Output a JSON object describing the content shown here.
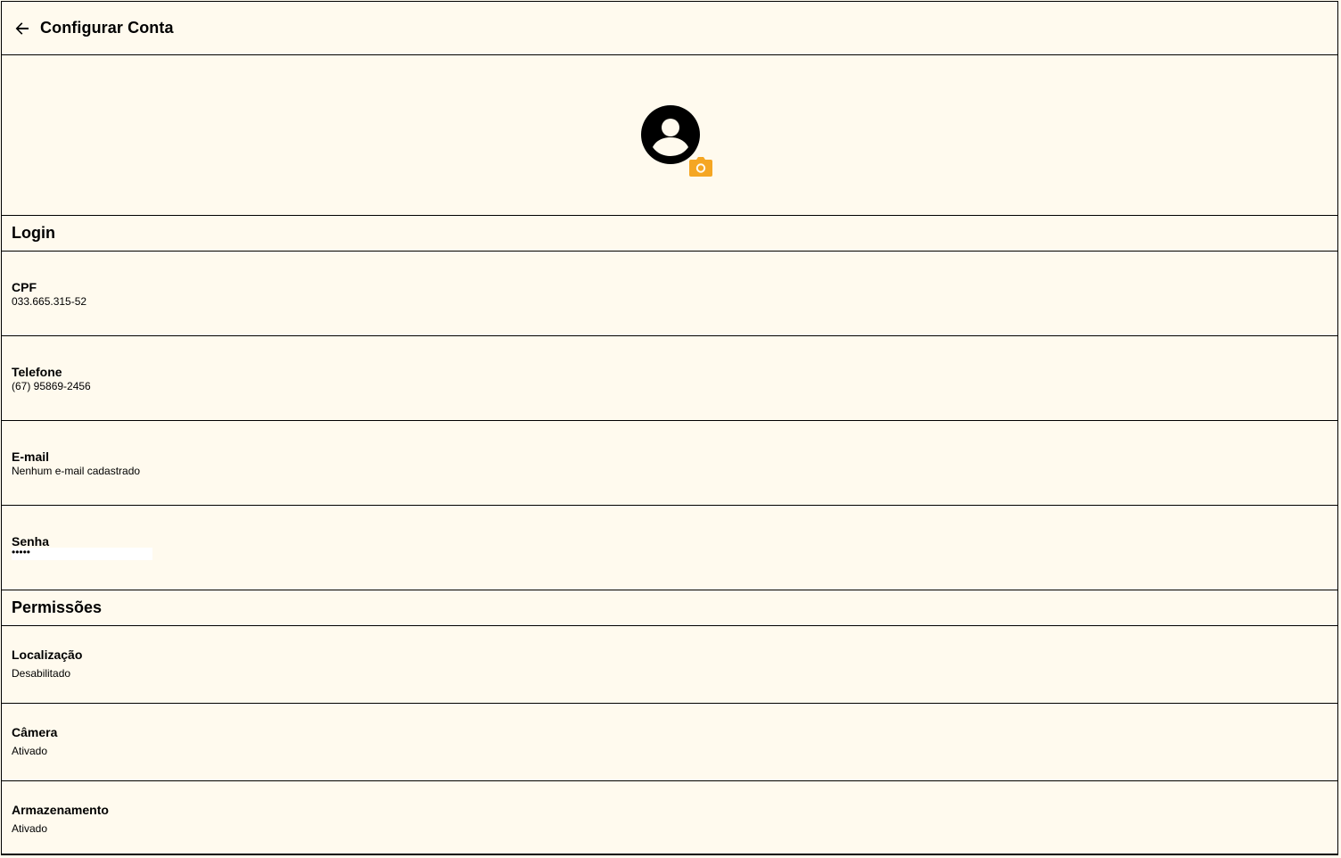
{
  "header": {
    "back_icon": "arrow-left-icon",
    "title": "Configurar Conta"
  },
  "profile": {
    "avatar_icon": "account-circle-icon",
    "camera_icon": "camera-icon",
    "camera_color": "#f5a623"
  },
  "login": {
    "section_title": "Login",
    "cpf": {
      "label": "CPF",
      "value": "033.665.315-52"
    },
    "telefone": {
      "label": "Telefone",
      "value": "(67) 95869-2456"
    },
    "email": {
      "label": "E-mail",
      "value": "Nenhum e-mail cadastrado"
    },
    "senha": {
      "label": "Senha",
      "value": "•••••"
    }
  },
  "permissoes": {
    "section_title": "Permissões",
    "localizacao": {
      "label": "Localização",
      "value": "Desabilitado"
    },
    "camera": {
      "label": "Câmera",
      "value": "Ativado"
    },
    "armazenamento": {
      "label": "Armazenamento",
      "value": "Ativado"
    }
  },
  "colors": {
    "background": "#fffaee",
    "accent": "#f5a623",
    "border": "#000000"
  }
}
